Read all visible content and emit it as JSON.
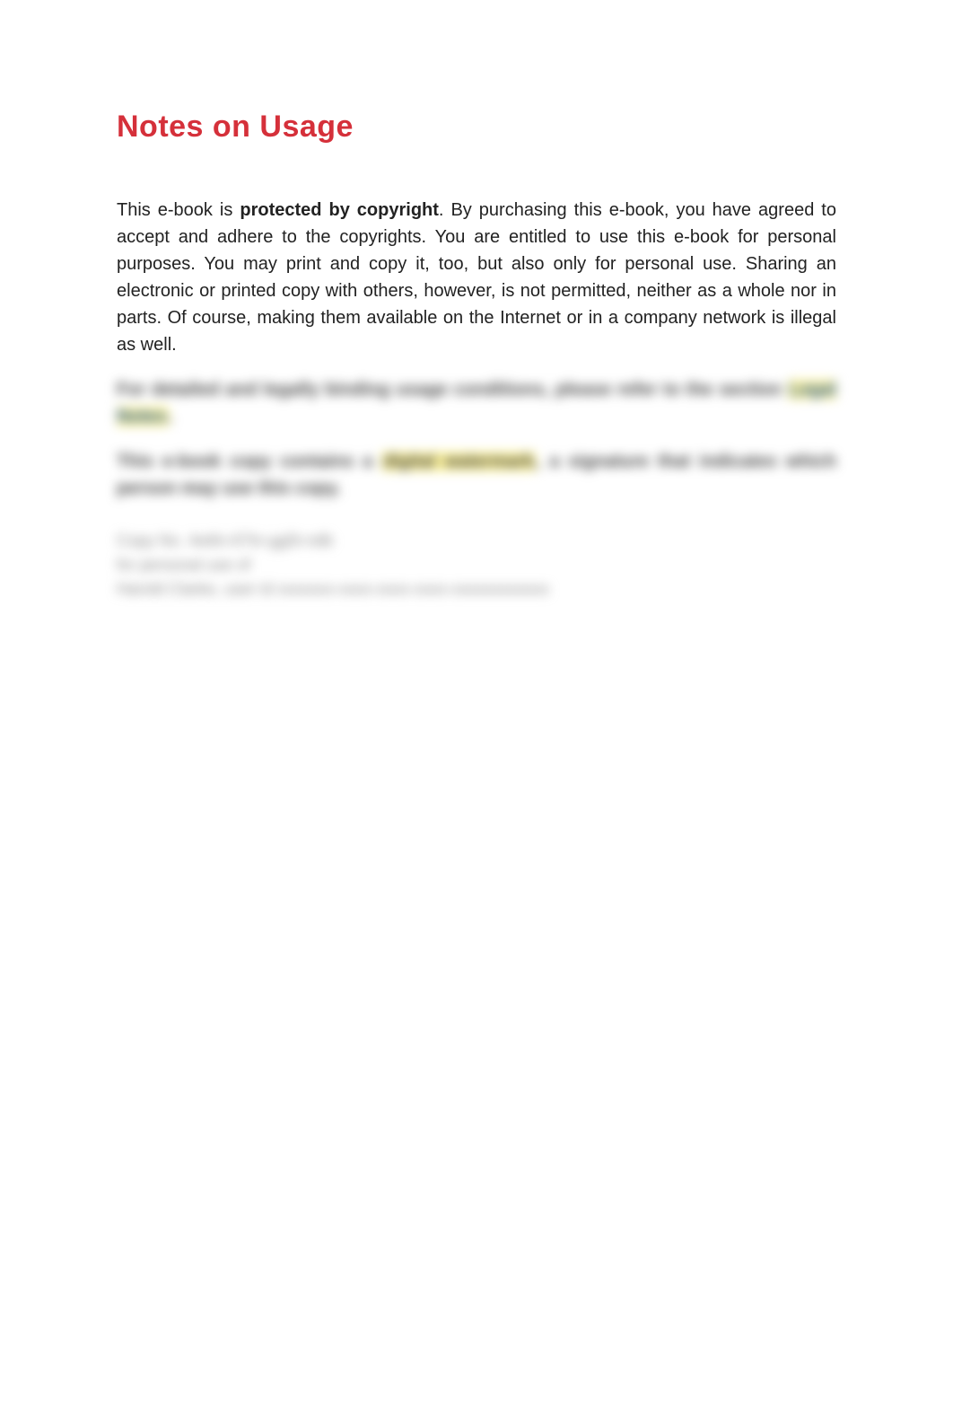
{
  "heading": "Notes on Usage",
  "para1": {
    "prefix": "This e-book is ",
    "bold": "protected by copyright",
    "suffix": ". By purchasing this e-book, you have agreed to accept and adhere to the copyrights. You are entitled to use this e-book for personal purposes. You may print and copy it, too, but also only for personal use. Sharing an electronic or printed copy with others, however, is not permitted, neither as a whole nor in parts. Of course, making them available on the Internet or in a company network is illegal as well."
  },
  "blurred": {
    "line1a": "For detailed and legally binding usage conditions, please refer to the section ",
    "line1b": "Legal Notes",
    "line1c": ".",
    "line2a": "This e-book copy contains a ",
    "line2b": "digital watermark",
    "line2c": ", a signature that indicates which person may use this copy.",
    "footer1": "Copy No. 4w6n-67tn-gg5t-ndb",
    "footer2": "for personal use of",
    "footer3": "Harold Clarke, user id xxxxxxx-xxxx-xxxx-xxxx-xxxxxxxxxxxx"
  }
}
